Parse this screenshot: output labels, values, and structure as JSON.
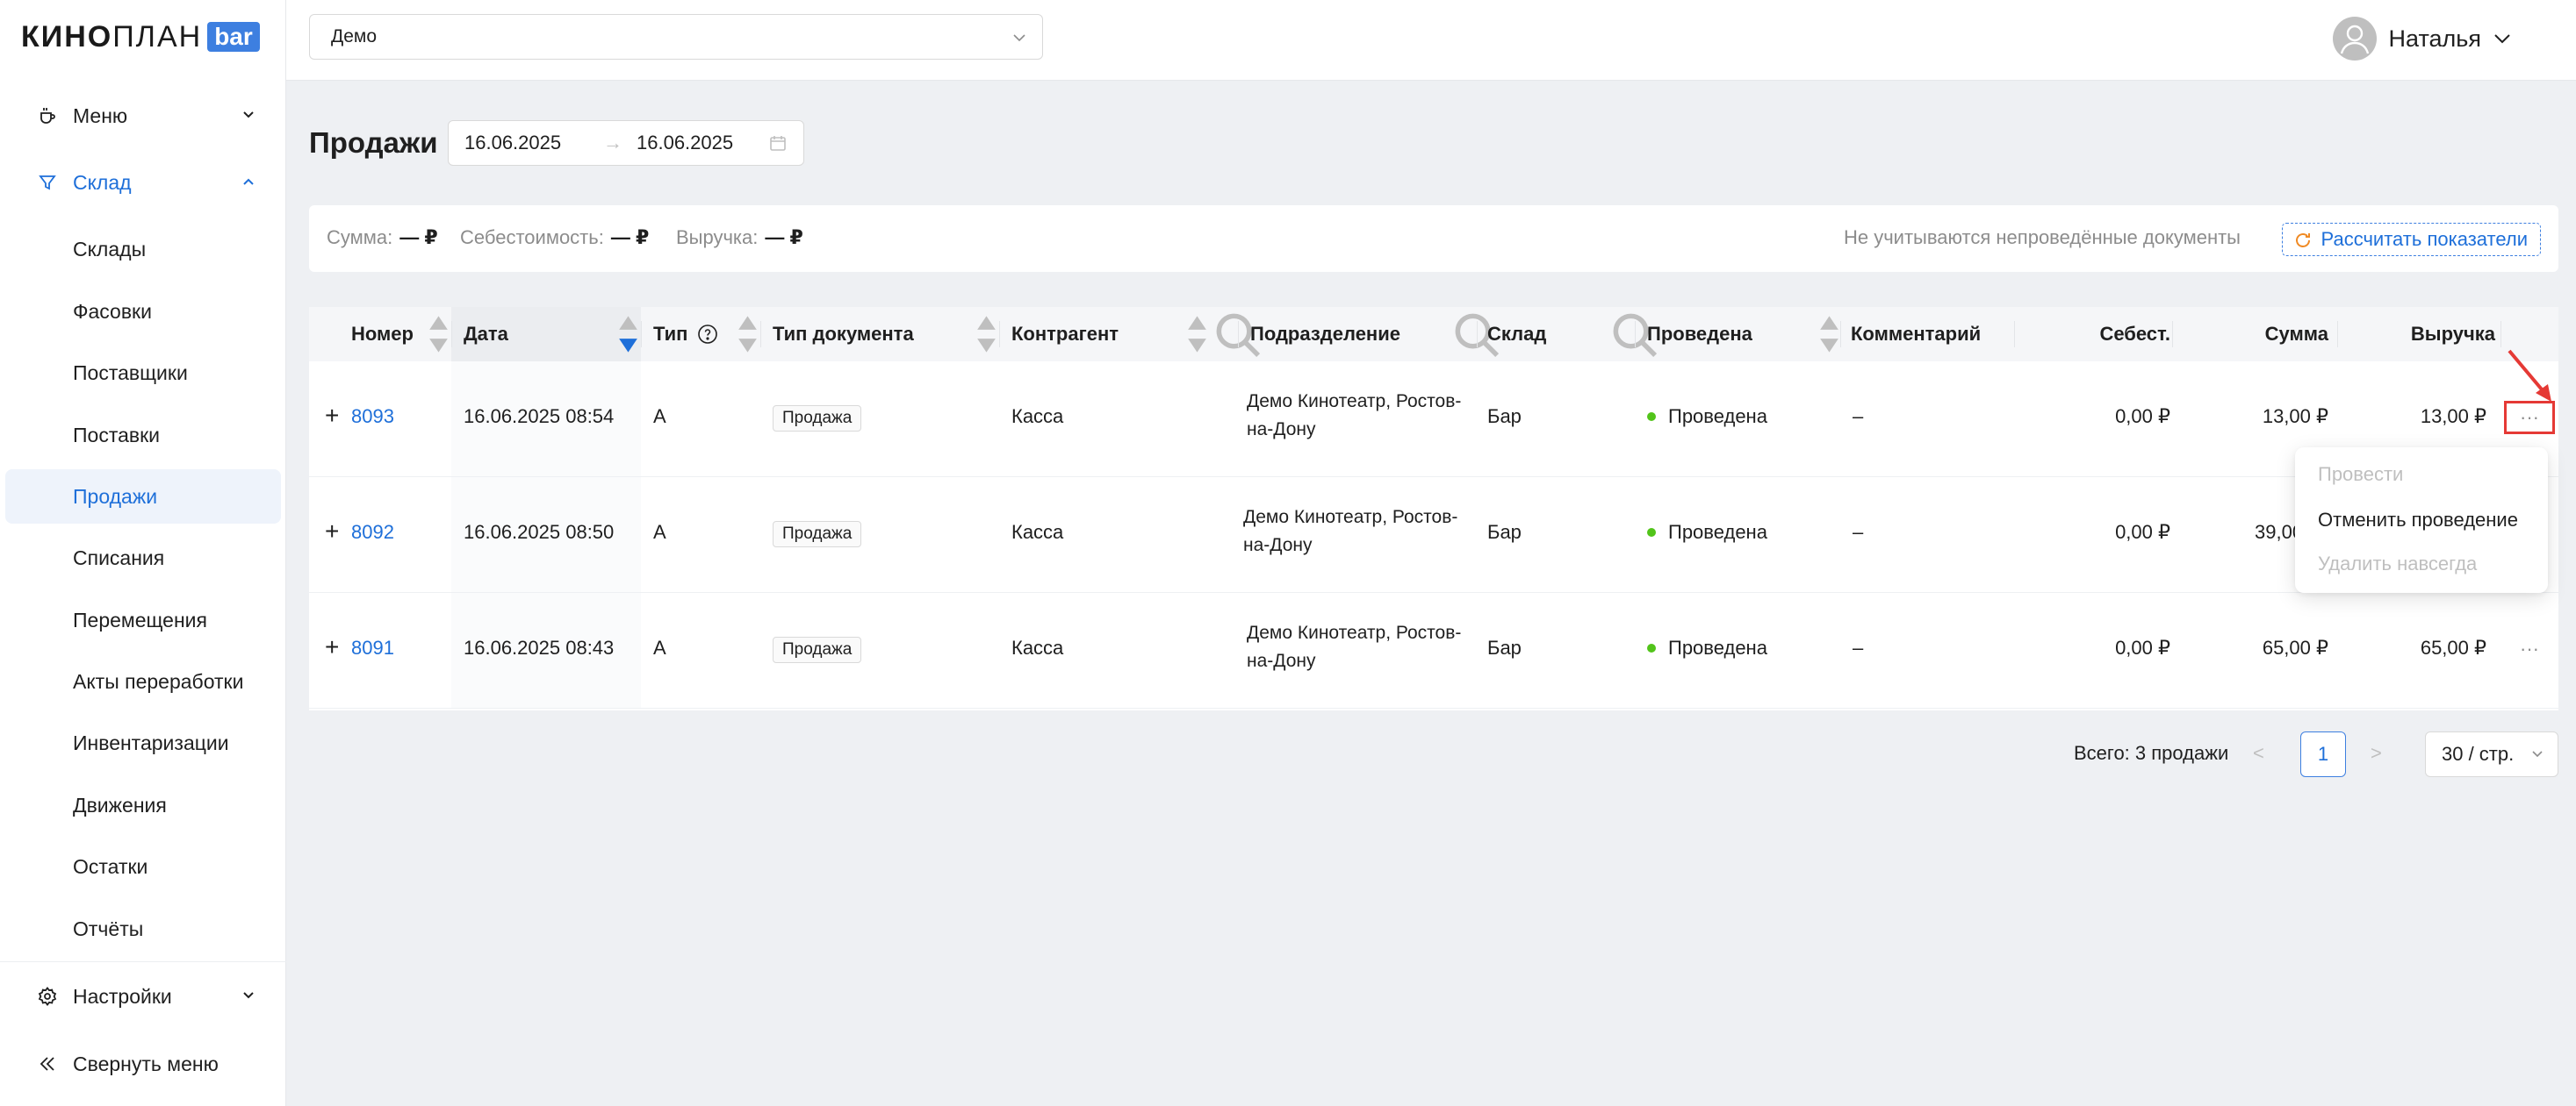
{
  "logo": {
    "brand_bold": "КИНО",
    "brand_thin": "ПЛАН",
    "badge": "bar"
  },
  "sidebar": {
    "menu_label": "Меню",
    "warehouse_label": "Склад",
    "items": [
      "Склады",
      "Фасовки",
      "Поставщики",
      "Поставки",
      "Продажи",
      "Списания",
      "Перемещения",
      "Акты переработки",
      "Инвентаризации",
      "Движения",
      "Остатки",
      "Отчёты"
    ],
    "settings_label": "Настройки",
    "collapse_label": "Свернуть меню",
    "accent_color": "#1e6fd9"
  },
  "topbar": {
    "org_value": "Демо",
    "user_name": "Наталья"
  },
  "page": {
    "title": "Продажи",
    "date_from": "16.06.2025",
    "date_to": "16.06.2025",
    "date_arrow": "→"
  },
  "summary": {
    "sum_label": "Сумма:",
    "sum_value": "— ₽",
    "cost_label": "Себестоимость:",
    "cost_value": "— ₽",
    "revenue_label": "Выручка:",
    "revenue_value": "— ₽",
    "note": "Не учитываются непроведённые документы",
    "calc_button": "Рассчитать показатели"
  },
  "table": {
    "headers": {
      "number": "Номер",
      "date": "Дата",
      "type": "Тип",
      "doc_type": "Тип документа",
      "counterparty": "Контрагент",
      "division": "Подразделение",
      "warehouse": "Склад",
      "posted": "Проведена",
      "comment": "Комментарий",
      "cost": "Себест.",
      "sum": "Сумма",
      "revenue": "Выручка"
    },
    "rows": [
      {
        "expand": "+",
        "number": "8093",
        "date": "16.06.2025 08:54",
        "type": "А",
        "doc_type": "Продажа",
        "counterparty": "Касса",
        "division": "Демо Кинотеатр, Ростов-на-Дону",
        "warehouse": "Бар",
        "posted": "Проведена",
        "comment": "–",
        "cost": "0,00 ₽",
        "sum": "13,00 ₽",
        "revenue": "13,00 ₽",
        "more": "···"
      },
      {
        "expand": "+",
        "number": "8092",
        "date": "16.06.2025 08:50",
        "type": "А",
        "doc_type": "Продажа",
        "counterparty": "Касса",
        "division": "Демо Кинотеатр, Ростов-на-Дону",
        "warehouse": "Бар",
        "posted": "Проведена",
        "comment": "–",
        "cost": "0,00 ₽",
        "sum": "39,00",
        "revenue": "",
        "more": ""
      },
      {
        "expand": "+",
        "number": "8091",
        "date": "16.06.2025 08:43",
        "type": "А",
        "doc_type": "Продажа",
        "counterparty": "Касса",
        "division": "Демо Кинотеатр, Ростов-на-Дону",
        "warehouse": "Бар",
        "posted": "Проведена",
        "comment": "–",
        "cost": "0,00 ₽",
        "sum": "65,00 ₽",
        "revenue": "65,00 ₽",
        "more": "···"
      }
    ]
  },
  "dropdown": {
    "options": [
      "Провести",
      "Отменить проведение",
      "Удалить навсегда"
    ]
  },
  "pager": {
    "total": "Всего: 3 продажи",
    "prev": "<",
    "page": "1",
    "next": ">",
    "page_size": "30 / стр."
  },
  "colors": {
    "posted_dot": "#52c41a",
    "highlight": "#e53935",
    "link": "#1e6fd9"
  }
}
